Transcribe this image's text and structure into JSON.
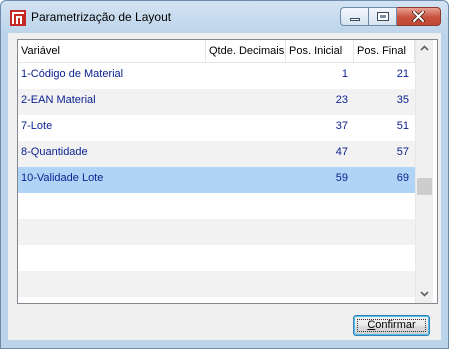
{
  "window": {
    "title": "Parametrização de Layout"
  },
  "table": {
    "columns": [
      {
        "label": "Variável"
      },
      {
        "label": "Qtde. Decimais"
      },
      {
        "label": "Pos. Inicial"
      },
      {
        "label": "Pos. Final"
      }
    ],
    "rows": [
      {
        "variavel": "1-Código de Material",
        "decimais": "",
        "pos_inicial": "1",
        "pos_final": "21"
      },
      {
        "variavel": "2-EAN Material",
        "decimais": "",
        "pos_inicial": "23",
        "pos_final": "35"
      },
      {
        "variavel": "7-Lote",
        "decimais": "",
        "pos_inicial": "37",
        "pos_final": "51"
      },
      {
        "variavel": "8-Quantidade",
        "decimais": "",
        "pos_inicial": "47",
        "pos_final": "57"
      },
      {
        "variavel": "10-Validade Lote",
        "decimais": "",
        "pos_inicial": "59",
        "pos_final": "69"
      }
    ],
    "selected_row": "10-Validade Lote"
  },
  "buttons": {
    "confirm_first": "C",
    "confirm_rest": "onfirmar"
  },
  "icons": {
    "app": "app-logo-icon",
    "minimize": "minimize-icon",
    "maximize": "maximize-icon",
    "close": "close-icon",
    "scroll_up": "chevron-up-icon",
    "scroll_down": "chevron-down-icon"
  },
  "colors": {
    "selection": "#b0d4f5",
    "row_text": "#0a1f8f",
    "close_button": "#c7513d"
  }
}
